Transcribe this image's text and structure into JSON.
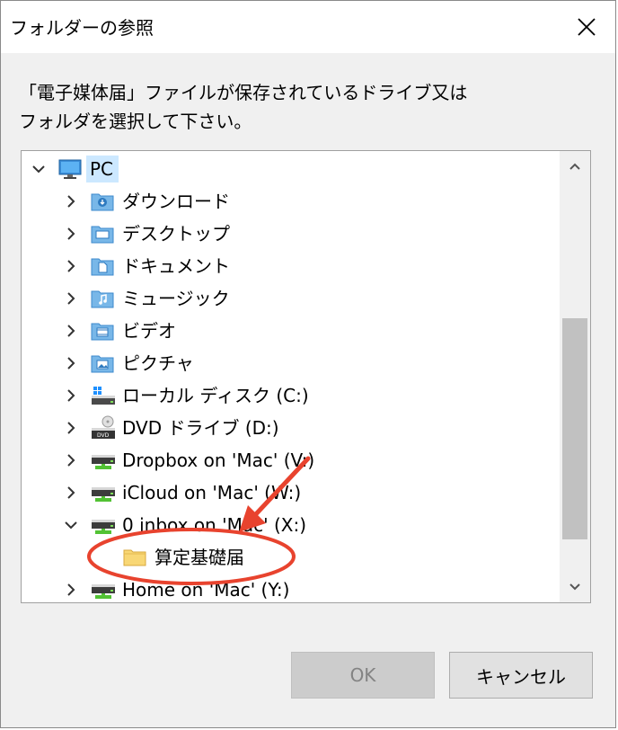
{
  "window": {
    "title": "フォルダーの参照"
  },
  "instructions": {
    "line1": "「電子媒体届」ファイルが保存されているドライブ又は",
    "line2": "フォルダを選択して下さい。"
  },
  "tree": {
    "items": [
      {
        "label": "PC",
        "icon": "pc-icon"
      },
      {
        "label": "ダウンロード",
        "icon": "downloads-folder-icon"
      },
      {
        "label": "デスクトップ",
        "icon": "desktop-folder-icon"
      },
      {
        "label": "ドキュメント",
        "icon": "documents-folder-icon"
      },
      {
        "label": "ミュージック",
        "icon": "music-folder-icon"
      },
      {
        "label": "ビデオ",
        "icon": "videos-folder-icon"
      },
      {
        "label": "ピクチャ",
        "icon": "pictures-folder-icon"
      },
      {
        "label": "ローカル ディスク (C:)",
        "icon": "local-disk-icon"
      },
      {
        "label": "DVD ドライブ (D:)",
        "icon": "dvd-drive-icon"
      },
      {
        "label": "Dropbox on 'Mac' (V:)",
        "icon": "network-drive-icon"
      },
      {
        "label": "iCloud on 'Mac' (W:)",
        "icon": "network-drive-icon"
      },
      {
        "label": "0 inbox on 'Mac' (X:)",
        "icon": "network-drive-icon"
      },
      {
        "label": "算定基礎届",
        "icon": "folder-icon"
      },
      {
        "label": "Home on 'Mac' (Y:)",
        "icon": "network-drive-icon"
      }
    ]
  },
  "buttons": {
    "ok": "OK",
    "cancel": "キャンセル"
  },
  "colors": {
    "selection": "#cce8ff",
    "annotation": "#e8432e",
    "folder": "#f8d775"
  }
}
